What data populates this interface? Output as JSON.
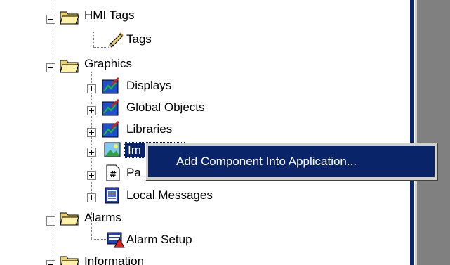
{
  "tree": {
    "hmi_tags": "HMI Tags",
    "tags": "Tags",
    "graphics": "Graphics",
    "displays": "Displays",
    "global_objects": "Global Objects",
    "libraries": "Libraries",
    "images": "Im",
    "parameters": "Pa",
    "local_messages": "Local Messages",
    "alarms": "Alarms",
    "alarm_setup": "Alarm Setup",
    "information": "Information"
  },
  "context_menu": {
    "item": "Add Component Into Application..."
  },
  "colors": {
    "selection": "#0a246a",
    "menu_bg": "#d4d0c8",
    "panel_gray": "#808080"
  }
}
